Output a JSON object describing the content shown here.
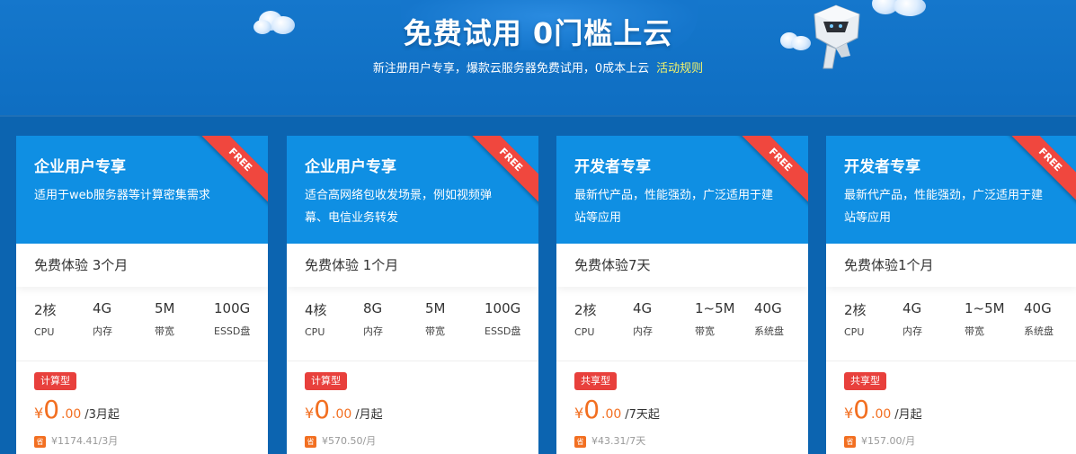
{
  "hero": {
    "title": "免费试用 0门槛上云",
    "subtitle": "新注册用户专享，爆款云服务器免费试用，0成本上云",
    "rules_link": "活动规则"
  },
  "colors": {
    "card_header": "#0f8fe3",
    "ribbon": "#f0473e",
    "tag": "#e8403c",
    "price": "#f26f21",
    "rules_link": "#f3f36b"
  },
  "ribbon_text": "FREE",
  "cards": [
    {
      "title": "企业用户专享",
      "desc": "适用于web服务器等计算密集需求",
      "trial": "免费体验 3个月",
      "specs": [
        {
          "value": "2核",
          "label": "CPU"
        },
        {
          "value": "4G",
          "label": "内存"
        },
        {
          "value": "5M",
          "label": "带宽"
        },
        {
          "value": "100G",
          "label": "ESSD盘"
        }
      ],
      "tag": "计算型",
      "currency": "¥",
      "price_int": "0",
      "price_dec": ".00",
      "price_unit": "/3月起",
      "orig_badge": "省",
      "orig_price": "¥1174.41/3月"
    },
    {
      "title": "企业用户专享",
      "desc": "适合高网络包收发场景，例如视频弹幕、电信业务转发",
      "trial": "免费体验 1个月",
      "specs": [
        {
          "value": "4核",
          "label": "CPU"
        },
        {
          "value": "8G",
          "label": "内存"
        },
        {
          "value": "5M",
          "label": "带宽"
        },
        {
          "value": "100G",
          "label": "ESSD盘"
        }
      ],
      "tag": "计算型",
      "currency": "¥",
      "price_int": "0",
      "price_dec": ".00",
      "price_unit": "/月起",
      "orig_badge": "省",
      "orig_price": "¥570.50/月"
    },
    {
      "title": "开发者专享",
      "desc": "最新代产品，性能强劲，广泛适用于建站等应用",
      "trial": "免费体验7天",
      "specs": [
        {
          "value": "2核",
          "label": "CPU"
        },
        {
          "value": "4G",
          "label": "内存"
        },
        {
          "value": "1~5M",
          "label": "带宽"
        },
        {
          "value": "40G",
          "label": "系统盘"
        }
      ],
      "tag": "共享型",
      "currency": "¥",
      "price_int": "0",
      "price_dec": ".00",
      "price_unit": "/7天起",
      "orig_badge": "省",
      "orig_price": "¥43.31/7天"
    },
    {
      "title": "开发者专享",
      "desc": "最新代产品，性能强劲，广泛适用于建站等应用",
      "trial": "免费体验1个月",
      "specs": [
        {
          "value": "2核",
          "label": "CPU"
        },
        {
          "value": "4G",
          "label": "内存"
        },
        {
          "value": "1~5M",
          "label": "带宽"
        },
        {
          "value": "40G",
          "label": "系统盘"
        }
      ],
      "tag": "共享型",
      "currency": "¥",
      "price_int": "0",
      "price_dec": ".00",
      "price_unit": "/月起",
      "orig_badge": "省",
      "orig_price": "¥157.00/月"
    }
  ]
}
